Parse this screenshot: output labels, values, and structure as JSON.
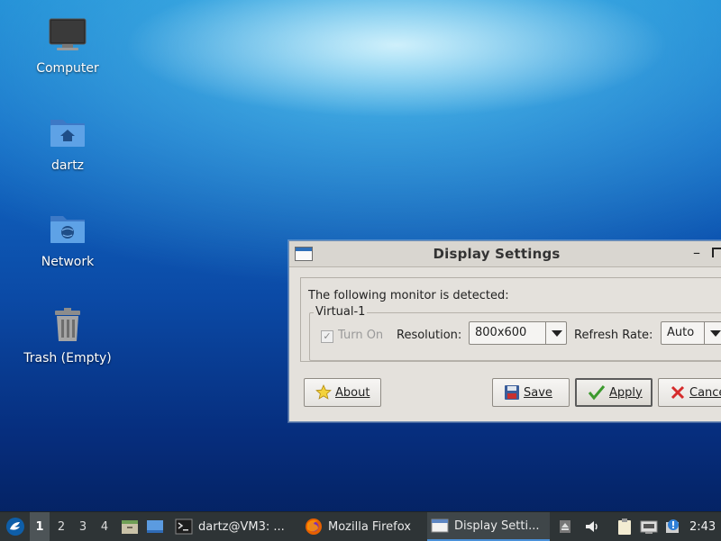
{
  "desktop": {
    "icons": [
      {
        "label": "Computer"
      },
      {
        "label": "dartz"
      },
      {
        "label": "Network"
      },
      {
        "label": "Trash (Empty)"
      }
    ]
  },
  "dialog": {
    "title": "Display Settings",
    "detected_text": "The following monitor is detected:",
    "monitor_name": "Virtual-1",
    "turn_on_label": "Turn On",
    "turn_on_checked": true,
    "resolution_label": "Resolution:",
    "resolution_value": "800x600",
    "refresh_label": "Refresh Rate:",
    "refresh_value": "Auto",
    "buttons": {
      "about": "About",
      "save": "Save",
      "apply": "Apply",
      "cancel": "Cance"
    }
  },
  "taskbar": {
    "workspaces": [
      "1",
      "2",
      "3",
      "4"
    ],
    "active_workspace": "1",
    "tasks": [
      {
        "label": "dartz@VM3: ...",
        "icon": "terminal-icon"
      },
      {
        "label": "Mozilla Firefox",
        "icon": "firefox-icon"
      },
      {
        "label": "Display Setti...",
        "icon": "window-icon"
      }
    ],
    "clock": "2:43"
  },
  "colors": {
    "taskbar_bg": "#2e3436",
    "dialog_bg": "#e4e1dc",
    "accent": "#4a90d9"
  }
}
